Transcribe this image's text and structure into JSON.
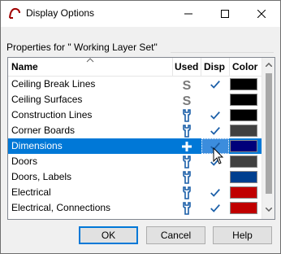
{
  "window": {
    "title": "Display Options"
  },
  "group": {
    "label": "Properties for \" Working Layer Set\""
  },
  "columns": {
    "name": "Name",
    "used": "Used",
    "disp": "Disp",
    "color": "Color"
  },
  "rows": [
    {
      "name": "Ceiling Break Lines",
      "used": "s-icon",
      "disp": true,
      "color": "#000000"
    },
    {
      "name": "Ceiling Surfaces",
      "used": "s-icon",
      "disp": false,
      "color": "#000000"
    },
    {
      "name": "Construction Lines",
      "used": "wrench-icon",
      "disp": true,
      "color": "#000000"
    },
    {
      "name": "Corner Boards",
      "used": "wrench-icon",
      "disp": true,
      "color": "#404040"
    },
    {
      "name": "Dimensions",
      "used": "plus-icon",
      "disp": true,
      "color": "#00007a",
      "selected": true
    },
    {
      "name": "Doors",
      "used": "wrench-icon",
      "disp": true,
      "color": "#404040"
    },
    {
      "name": "Doors, Labels",
      "used": "wrench-icon",
      "disp": false,
      "color": "#003f8f"
    },
    {
      "name": "Electrical",
      "used": "wrench-icon",
      "disp": true,
      "color": "#c00000"
    },
    {
      "name": "Electrical, Connections",
      "used": "wrench-icon",
      "disp": true,
      "color": "#c00000"
    }
  ],
  "buttons": {
    "ok": "OK",
    "cancel": "Cancel",
    "help": "Help"
  },
  "colors": {
    "check": "#1b5fa8",
    "selection": "#0078d7",
    "icon_gray": "#7a7a7a",
    "icon_blue": "#1b5fa8"
  }
}
